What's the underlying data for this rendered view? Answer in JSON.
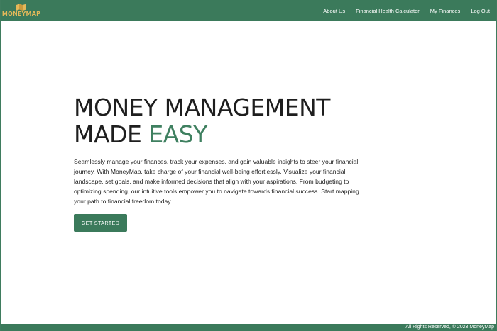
{
  "header": {
    "brand_name": "MONEYMAP",
    "logo_icon": "folded-map-icon",
    "nav_links": [
      {
        "label": "About Us"
      },
      {
        "label": "Financial Health Calculator"
      },
      {
        "label": "My Finances"
      },
      {
        "label": "Log Out"
      }
    ]
  },
  "hero": {
    "headline_line1": "MONEY MANAGEMENT",
    "headline_line2_plain": "MADE ",
    "headline_line2_accent": "EASY",
    "description": "Seamlessly manage your finances, track your expenses, and gain valuable insights to steer your financial journey. With MoneyMap, take charge of your financial well-being effortlessly. Visualize your financial landscape, set goals, and make informed decisions that align with your aspirations. From budgeting to optimizing spending, our intuitive tools empower you to navigate towards financial success. Start mapping your path to financial freedom today",
    "cta_label": "GET STARTED"
  },
  "footer": {
    "text": "All Rights Reserved, © 2023 MoneyMap"
  },
  "colors": {
    "primary_green": "#3b7a5b",
    "accent_green": "#3f8060",
    "brand_gold": "#e3b85a",
    "text_dark": "#1e1e1e"
  }
}
